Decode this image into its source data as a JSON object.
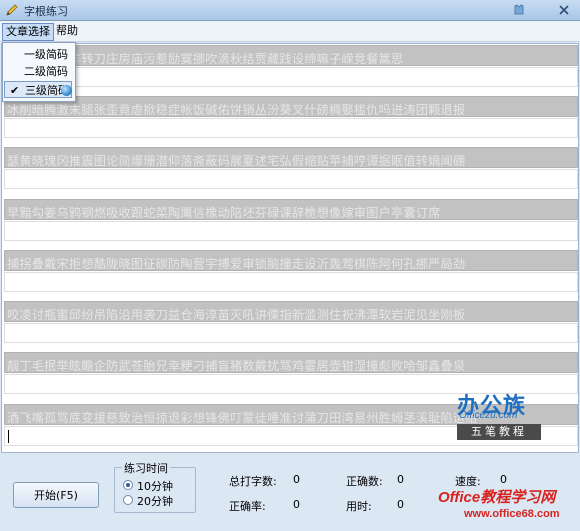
{
  "window": {
    "title": "字根练习"
  },
  "menu": {
    "items": [
      "文章选择",
      "帮助"
    ],
    "dropdown": [
      {
        "label": "一级简码",
        "checked": false
      },
      {
        "label": "二级简码",
        "checked": false
      },
      {
        "label": "三级简码",
        "checked": true
      }
    ]
  },
  "practice": {
    "lines": [
      "司琳宣沫筏羊转刀庄房庙污惹励寞挪吹滴秋结贾藏践设缔嘛子嵘竞餐篙思",
      "冰削暗腾激末腿张歪竟虐掀稳症帐饭碱佑饼销丛汾葵叉什磅稠娶槛仇吗迸涛团颗退报",
      "瑟黄晓瑰冈推震图论简爆珊潜仰落斋蔽码展夏述宅弘假缩贴苹捕哼谭据眠值转嫡闻硼",
      "早黯勾姜乌鸦钢燃吸收跟蛇菜陶鹰信橡动陪坯芬碌课辞桅想像嫁审图户亭囊订席",
      "捕拐叠戴宋拒想酷陇晓图征碳防陶营宇搏爱审锁脑撞走设沂轰莺棋陈阿何孔挪严局劲",
      "咬凌讨瓶蜜邱纷吊陷沿用袭刀益仓海淳苗灭吼讲傈指新滥测住祝沸潭软岩泥见坐刚板",
      "靓丁毛抿举眩瞻企防武苍胎兄幸粳刁捕盲猪数戴扰骂鸡霎居壶钳湿撞彪败哈邹鑫叠泉",
      "酒飞嘴孤骂底变援慈致治恒掠退彩想锋佛叮蒙徒唾准讨蒲刀田湾易州胜姆茎溪耻陷运给"
    ]
  },
  "controls": {
    "start_label": "开始(F5)",
    "time_group_title": "练习时间",
    "time_options": [
      {
        "label": "10分钟",
        "selected": true
      },
      {
        "label": "20分钟",
        "selected": false
      }
    ]
  },
  "stats": {
    "total_label": "总打字数:",
    "total_value": "0",
    "correct_label": "正确数:",
    "correct_value": "0",
    "speed_label": "速度:",
    "speed_value": "0",
    "accuracy_label": "正确率:",
    "accuracy_value": "0",
    "time_label": "用时:",
    "time_value": "0"
  },
  "watermark": {
    "logo_main": "办公族",
    "logo_domain": "Officezu.com",
    "logo_sub": "五笔教程",
    "site_name": "Office教程学习网",
    "site_url": "www.office68.com"
  },
  "colors": {
    "line_bg": "#c2c2c2",
    "watermark_red": "#d8231f",
    "logo_blue": "#1f6fc1"
  }
}
